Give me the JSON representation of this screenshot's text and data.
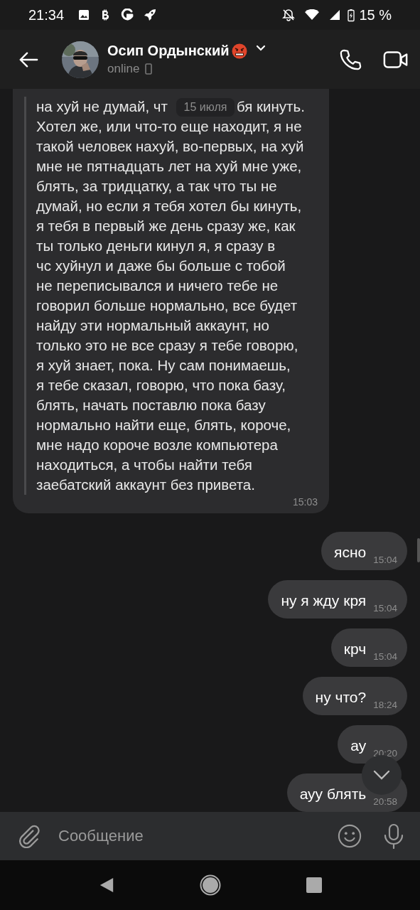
{
  "status_bar": {
    "time": "21:34",
    "battery": "15 %"
  },
  "header": {
    "name": "Осип Ордынский",
    "status": "online"
  },
  "date_badge": "15 июля",
  "messages": [
    {
      "kind": "in",
      "lines": [
        [
          "на хуй не думай, чт",
          "бя кинуть."
        ],
        "Хотел же, или что-то еще находит, я не",
        "такой человек нахуй, во-первых, на хуй",
        "мне не пятнадцать лет на хуй мне уже,",
        "блять, за тридцатку, а так что ты не",
        "думай, но если я тебя хотел бы кинуть,",
        "я тебя в первый же день сразу же, как",
        "ты только деньги кинул я, я сразу в",
        "чс хуйнул и даже бы больше с тобой",
        "не переписывался и ничего тебе не",
        "говорил больше нормально, все будет",
        "найду эти нормальный аккаунт, но",
        "только это не все сразу я тебе говорю,",
        "я хуй знает, пока. Ну сам понимаешь,",
        "я тебе сказал, говорю, что пока базу,",
        "блять, начать поставлю пока базу",
        "нормально найти еще, блять, короче,",
        "мне надо короче возле компьютера",
        "находиться, а чтобы найти тебя",
        "заебатский аккаунт без привета."
      ],
      "time": "15:03"
    },
    {
      "kind": "out",
      "text": "ясно",
      "time": "15:04"
    },
    {
      "kind": "out",
      "text": "ну я жду кря",
      "time": "15:04"
    },
    {
      "kind": "out",
      "text": "крч",
      "time": "15:04"
    },
    {
      "kind": "out",
      "text": "ну что?",
      "time": "18:24"
    },
    {
      "kind": "out",
      "text": "ау",
      "time": "20:20"
    },
    {
      "kind": "out",
      "text": "ауу блять",
      "time": "20:58"
    }
  ],
  "composer": {
    "placeholder": "Сообщение"
  }
}
